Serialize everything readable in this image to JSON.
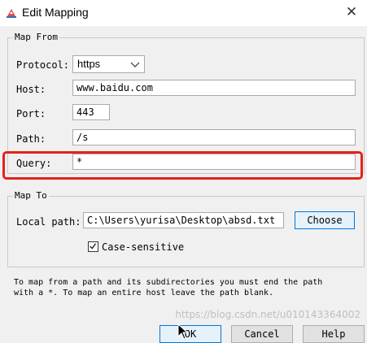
{
  "window": {
    "title": "Edit Mapping",
    "title_icon": "java-app-icon",
    "close_icon": "close-icon"
  },
  "map_from": {
    "legend": "Map From",
    "protocol_label": "Protocol:",
    "protocol_value": "https",
    "host_label": "Host:",
    "host_value": "www.baidu.com",
    "port_label": "Port:",
    "port_value": "443",
    "path_label": "Path:",
    "path_value": "/s",
    "query_label": "Query:",
    "query_value": "*"
  },
  "map_to": {
    "legend": "Map To",
    "local_path_label": "Local path:",
    "local_path_value": "C:\\Users\\yurisa\\Desktop\\absd.txt",
    "choose_label": "Choose",
    "case_sensitive_label": "Case-sensitive",
    "case_sensitive_checked": true
  },
  "hint": {
    "line1": "To map from a path and its subdirectories you must end the path",
    "line2": "with a *. To map an entire host leave the path blank."
  },
  "buttons": {
    "ok": "OK",
    "cancel": "Cancel",
    "help": "Help"
  },
  "watermark": "https://blog.csdn.net/u010143364002",
  "colors": {
    "highlight": "#e2231a",
    "background": "#f0f0f0"
  }
}
